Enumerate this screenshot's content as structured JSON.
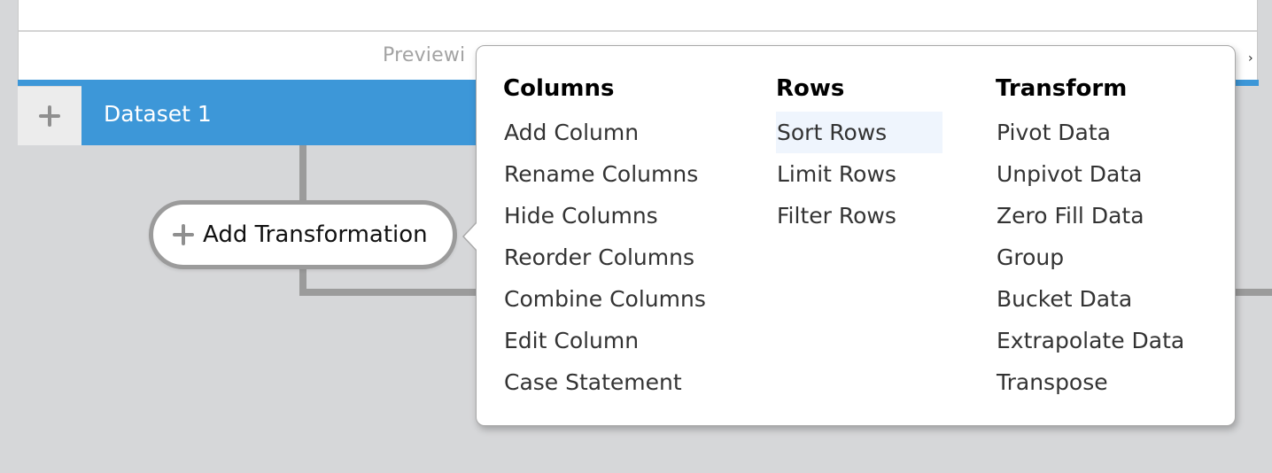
{
  "preview": {
    "text": "Previewi",
    "next_icon": "chevron-right-icon"
  },
  "dataset": {
    "add_icon": "plus-icon",
    "tab_label": "Dataset 1",
    "color": "#3d97d8"
  },
  "transformation": {
    "add_icon": "plus-icon",
    "add_label": "Add Transformation"
  },
  "menu": {
    "columns": [
      {
        "heading": "Columns",
        "items": [
          "Add Column",
          "Rename Columns",
          "Hide Columns",
          "Reorder Columns",
          "Combine Columns",
          "Edit Column",
          "Case Statement"
        ]
      },
      {
        "heading": "Rows",
        "items": [
          "Sort Rows",
          "Limit Rows",
          "Filter Rows"
        ]
      },
      {
        "heading": "Transform",
        "items": [
          "Pivot Data",
          "Unpivot Data",
          "Zero Fill Data",
          "Group",
          "Bucket Data",
          "Extrapolate Data",
          "Transpose"
        ]
      }
    ],
    "hovered_item": "Sort Rows",
    "hover_color": "#eff5fd"
  }
}
